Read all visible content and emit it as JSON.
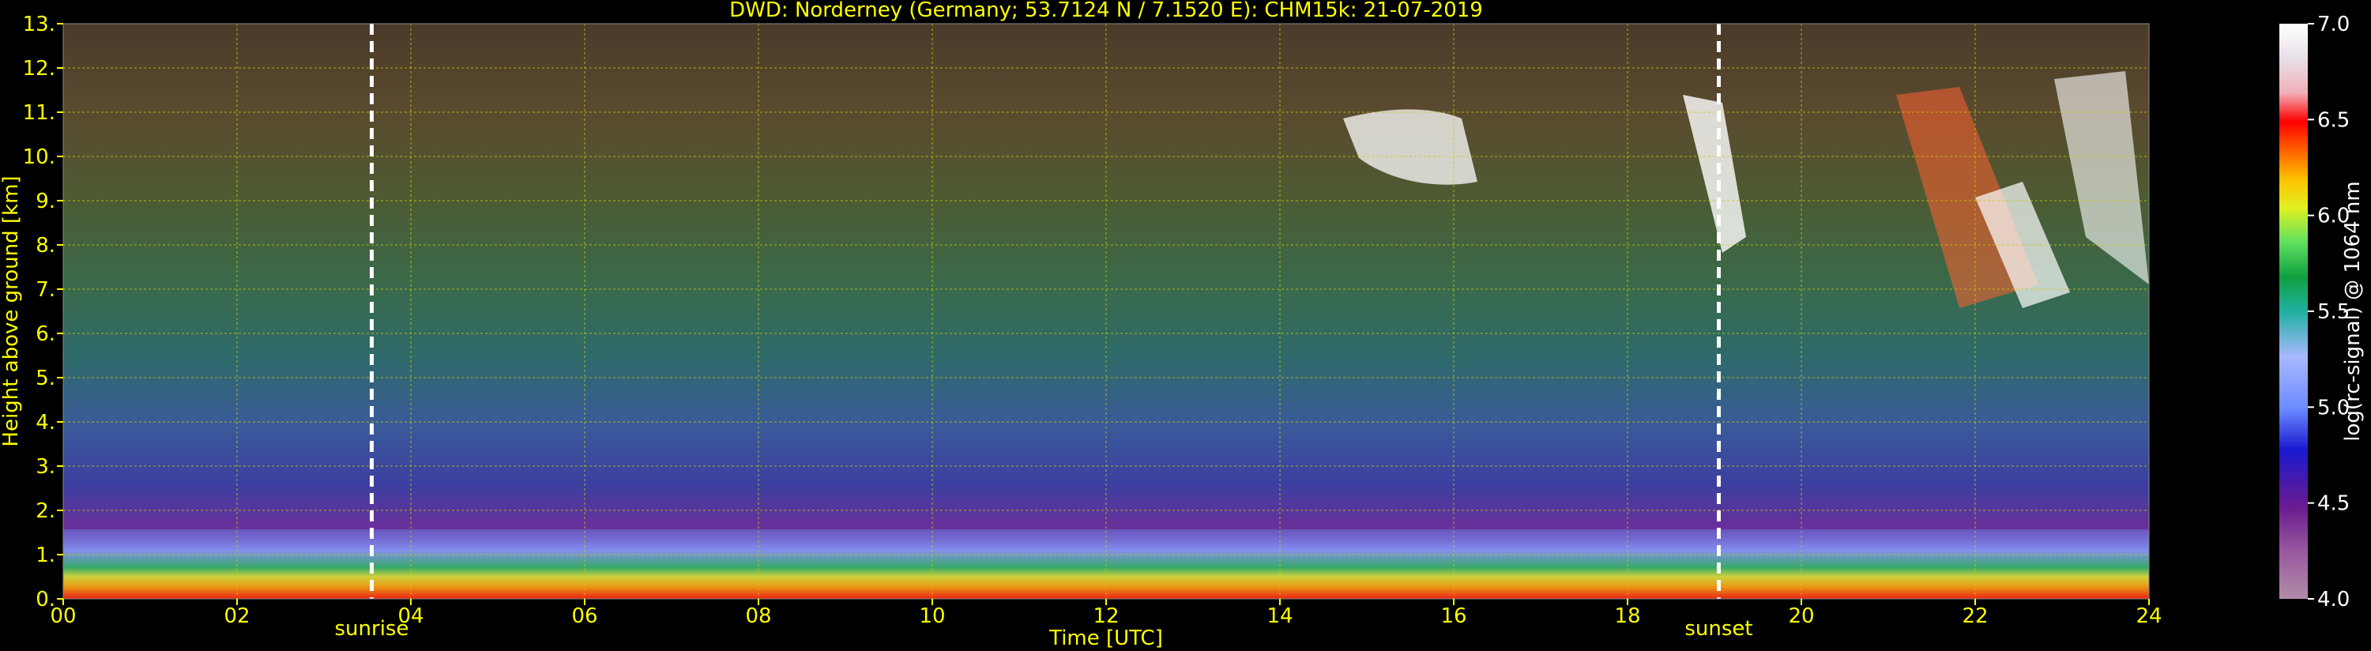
{
  "chart_data": {
    "type": "heatmap",
    "title": "DWD: Norderney (Germany; 53.7124 N / 7.1520 E):    CHM15k: 21-07-2019",
    "xlabel": "Time [UTC]",
    "ylabel": "Height above ground [km]",
    "xlim": [
      0,
      24
    ],
    "ylim": [
      0,
      13
    ],
    "x_ticks": [
      "00",
      "02",
      "04",
      "06",
      "08",
      "10",
      "12",
      "14",
      "16",
      "18",
      "20",
      "22",
      "24"
    ],
    "y_ticks": [
      "0.",
      "1.",
      "2.",
      "3.",
      "4.",
      "5.",
      "6.",
      "7.",
      "8.",
      "9.",
      "10.",
      "11.",
      "12.",
      "13."
    ],
    "grid": true,
    "colorbar": {
      "label": "log(rc-signal) @ 1064 nm",
      "range": [
        4.0,
        7.0
      ],
      "ticks": [
        "4.0",
        "4.5",
        "5.0",
        "5.5",
        "6.0",
        "6.5",
        "7.0"
      ]
    },
    "markers": [
      {
        "label": "sunrise",
        "x": 3.55
      },
      {
        "label": "sunset",
        "x": 19.05
      }
    ],
    "colors": {
      "text": "#ffff00",
      "grid": "#cccc00",
      "background": "#000000",
      "marker_line": "#ffffff"
    }
  }
}
